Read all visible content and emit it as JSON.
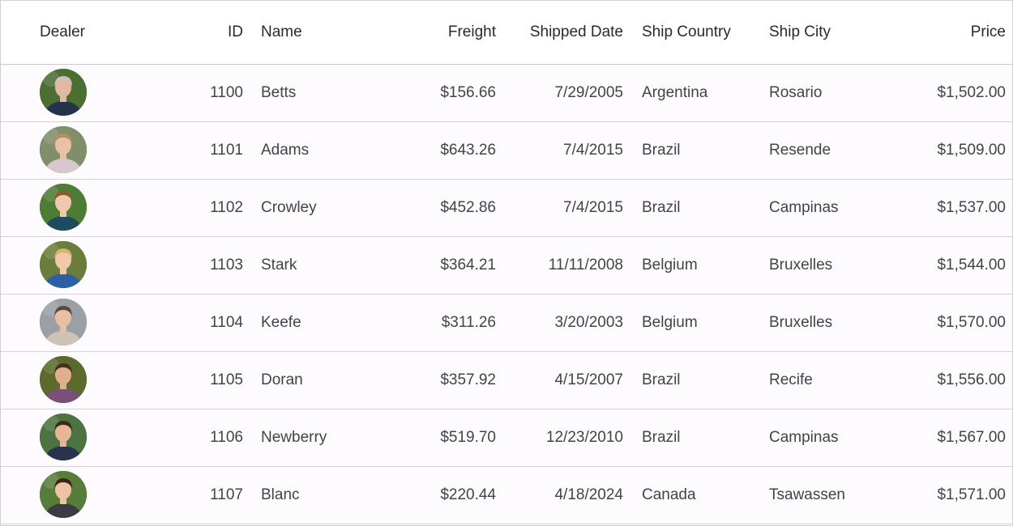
{
  "columns": {
    "dealer": "Dealer",
    "id": "ID",
    "name": "Name",
    "freight": "Freight",
    "shipped_date": "Shipped Date",
    "ship_country": "Ship Country",
    "ship_city": "Ship City",
    "price": "Price"
  },
  "rows": [
    {
      "id": "1100",
      "name": "Betts",
      "freight": "$156.66",
      "shipped_date": "7/29/2005",
      "ship_country": "Argentina",
      "ship_city": "Rosario",
      "price": "$1,502.00",
      "avatar": {
        "bg": "#4b6e33",
        "skin": "#e2b9a0",
        "hair": "#c9c4be",
        "shirt": "#26324a"
      }
    },
    {
      "id": "1101",
      "name": "Adams",
      "freight": "$643.26",
      "shipped_date": "7/4/2015",
      "ship_country": "Brazil",
      "ship_city": "Resende",
      "price": "$1,509.00",
      "avatar": {
        "bg": "#7e8f6a",
        "skin": "#e8c1a6",
        "hair": "#b58f63",
        "shirt": "#d9c7cf"
      }
    },
    {
      "id": "1102",
      "name": "Crowley",
      "freight": "$452.86",
      "shipped_date": "7/4/2015",
      "ship_country": "Brazil",
      "ship_city": "Campinas",
      "price": "$1,537.00",
      "avatar": {
        "bg": "#4f7c34",
        "skin": "#efc8ad",
        "hair": "#8a5a34",
        "shirt": "#1f4b5e"
      }
    },
    {
      "id": "1103",
      "name": "Stark",
      "freight": "$364.21",
      "shipped_date": "11/11/2008",
      "ship_country": "Belgium",
      "ship_city": "Bruxelles",
      "price": "$1,544.00",
      "avatar": {
        "bg": "#6b7d3b",
        "skin": "#f0c9a8",
        "hair": "#d8b46a",
        "shirt": "#2c5fa6"
      }
    },
    {
      "id": "1104",
      "name": "Keefe",
      "freight": "$311.26",
      "shipped_date": "3/20/2003",
      "ship_country": "Belgium",
      "ship_city": "Bruxelles",
      "price": "$1,570.00",
      "avatar": {
        "bg": "#9aa0a6",
        "skin": "#e7c0a3",
        "hair": "#5a4a3a",
        "shirt": "#cfc3b6"
      }
    },
    {
      "id": "1105",
      "name": "Doran",
      "freight": "$357.92",
      "shipped_date": "4/15/2007",
      "ship_country": "Brazil",
      "ship_city": "Recife",
      "price": "$1,556.00",
      "avatar": {
        "bg": "#5c6a2c",
        "skin": "#e0b08d",
        "hair": "#4a2f1f",
        "shirt": "#7a4f7a"
      }
    },
    {
      "id": "1106",
      "name": "Newberry",
      "freight": "$519.70",
      "shipped_date": "12/23/2010",
      "ship_country": "Brazil",
      "ship_city": "Campinas",
      "price": "$1,567.00",
      "avatar": {
        "bg": "#4d7340",
        "skin": "#e4b897",
        "hair": "#3b2a1e",
        "shirt": "#28344d"
      }
    },
    {
      "id": "1107",
      "name": "Blanc",
      "freight": "$220.44",
      "shipped_date": "4/18/2024",
      "ship_country": "Canada",
      "ship_city": "Tsawassen",
      "price": "$1,571.00",
      "avatar": {
        "bg": "#587d3a",
        "skin": "#ecc3a5",
        "hair": "#3a2418",
        "shirt": "#3c3a44"
      }
    }
  ]
}
